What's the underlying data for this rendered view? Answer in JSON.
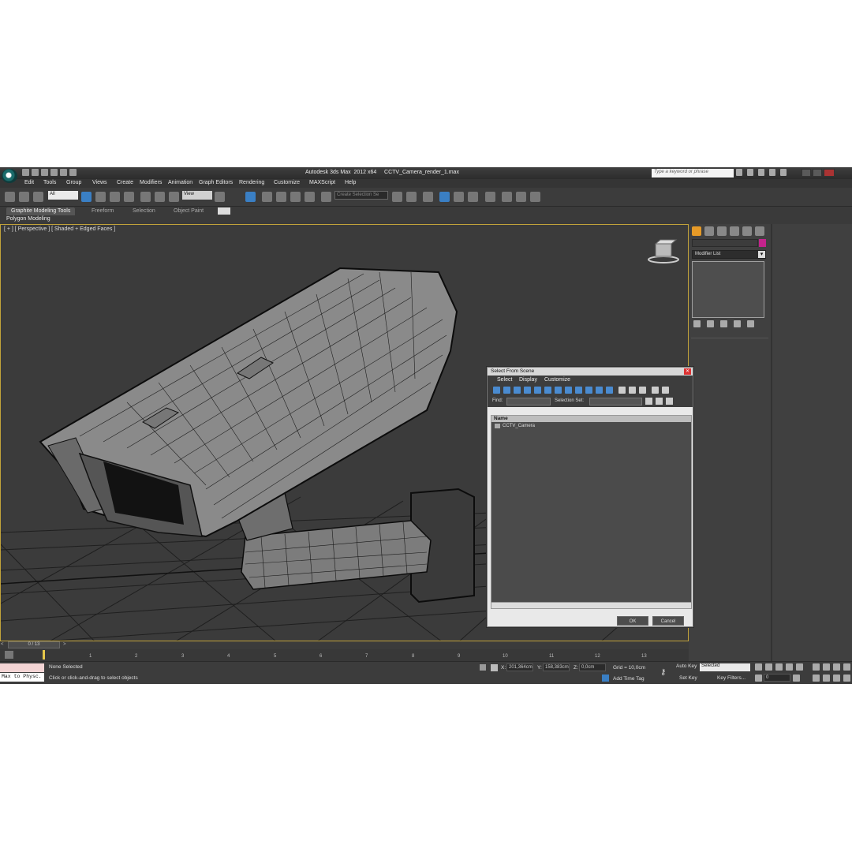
{
  "title": {
    "app": "Autodesk 3ds Max  2012 x64",
    "file": "CCTV_Camera_render_1.max",
    "search_placeholder": "Type a keyword or phrase"
  },
  "menu": [
    "Edit",
    "Tools",
    "Group",
    "Views",
    "Create",
    "Modifiers",
    "Animation",
    "Graph Editors",
    "Rendering",
    "Customize",
    "MAXScript",
    "Help"
  ],
  "toolbar": {
    "selection_filter": "All",
    "ref_coord": "View",
    "named_selection": "Create Selection Se"
  },
  "ribbon": {
    "tabs": [
      "Graphite Modeling Tools",
      "Freeform",
      "Selection",
      "Object Paint"
    ],
    "active_tab": "Graphite Modeling Tools",
    "sub_label": "Polygon Modeling"
  },
  "viewport": {
    "label": "[ + ] [ Perspective ] [ Shaded + Edged Faces ]"
  },
  "command_panel": {
    "modifier_list": "Modifier List",
    "object_color": "#c3238b"
  },
  "dialog": {
    "title": "Select From Scene",
    "menu": [
      "Select",
      "Display",
      "Customize"
    ],
    "find_label": "Find:",
    "selection_set_label": "Selection Set:",
    "column_name": "Name",
    "items": [
      "CCTV_Camera"
    ],
    "ok": "OK",
    "cancel": "Cancel"
  },
  "timeline": {
    "position": "0 / 13",
    "frames": [
      "1",
      "2",
      "3",
      "4",
      "5",
      "6",
      "7",
      "8",
      "9",
      "10",
      "11",
      "12",
      "13"
    ]
  },
  "status": {
    "maxscript": "Max to Physc.",
    "selection": "None Selected",
    "prompt": "Click or click-and-drag to select objects",
    "x_label": "X:",
    "x": "201,364cm",
    "y_label": "Y:",
    "y": "158,383cm",
    "z_label": "Z:",
    "z": "0,0cm",
    "grid": "Grid = 10,0cm",
    "add_time_tag": "Add Time Tag",
    "auto_key": "Auto Key",
    "set_key": "Set Key",
    "key_mode": "Selected",
    "key_filters": "Key Filters...",
    "frame": "0"
  }
}
